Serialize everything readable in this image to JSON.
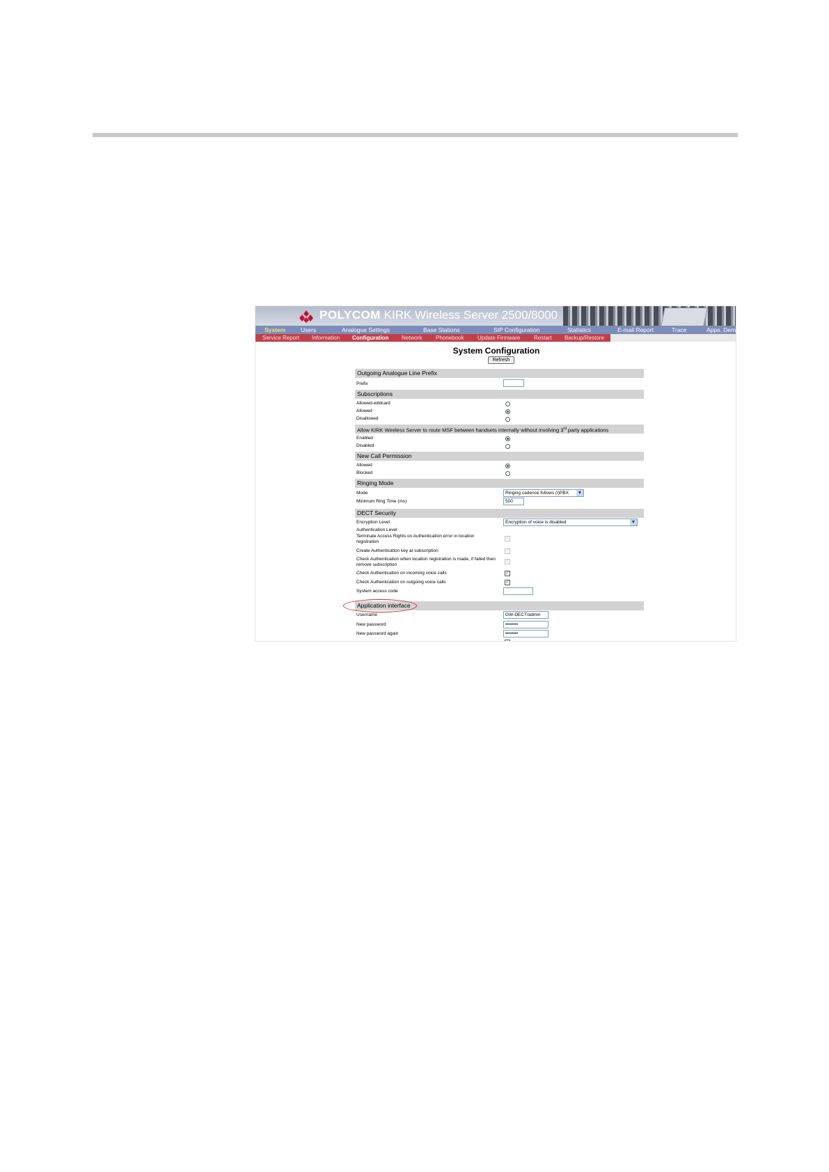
{
  "browser_screenshot": {
    "banner": {
      "brand": "POLYCOM",
      "product": "KIRK Wireless Server 2500/8000",
      "colors": {
        "logo": "#c8102e",
        "nav_main": "#7d8db9",
        "nav_sub": "#c0404a",
        "section_bar": "#d2d2d2",
        "highlight_ellipse": "#d12a2a"
      }
    },
    "main_nav": [
      "System",
      "Users",
      "Analogue Settings",
      "Base Stations",
      "SIP Configuration",
      "Statistics",
      "E-mail Report",
      "Trace",
      "Apps. Demo"
    ],
    "main_nav_selected": "System",
    "sub_nav": [
      "Service Report",
      "Information",
      "Configuration",
      "Network",
      "Phonebook",
      "Update Firmware",
      "Restart",
      "Backup/Restore"
    ],
    "sub_nav_selected": "Configuration",
    "page_title": "System Configuration",
    "refresh_label": "Refresh",
    "sections": {
      "outgoing_prefix": {
        "title": "Outgoing Analogue Line Prefix",
        "prefix_label": "Prefix",
        "prefix_value": ""
      },
      "subscriptions": {
        "title": "Subscriptions",
        "options": [
          "Allowed-wildcard",
          "Allowed",
          "Disallowed"
        ],
        "selected": "Allowed"
      },
      "route_msf": {
        "title_pre": "Allow KIRK Wireless Server to route MSF between handsets internally without involving 3",
        "title_sup": "rd",
        "title_post": " party applications",
        "options": [
          "Enabled",
          "Disabled"
        ],
        "selected": "Enabled"
      },
      "new_call": {
        "title": "New Call Permission",
        "options": [
          "Allowed",
          "Blocked"
        ],
        "selected": "Allowed"
      },
      "ringing": {
        "title": "Ringing Mode",
        "mode_label": "Mode",
        "mode_value": "Ringing cadence follows (I)PBX",
        "min_ring_label": "Minimum Ring Time (ms)",
        "min_ring_value": "500"
      },
      "dect_security": {
        "title": "DECT Security",
        "encryption_label": "Encryption Level",
        "encryption_value": "Encryption of voice is disabled",
        "auth_level_label": "Authentication Level",
        "terminate_label": "Terminate Access Rights on Authentication error in location registration",
        "create_key_label": "Create Authentication key at subscription",
        "check_location_label": "Check Authentication when location registration is made, if failed then remove subscription",
        "check_incoming_label": "Check Authentication on incoming voice calls",
        "check_outgoing_label": "Check Authentication on outgoing voice calls",
        "system_access_label": "System access code",
        "system_access_value": "",
        "checked_states": {
          "terminate": true,
          "create_key": true,
          "check_location": true,
          "check_incoming": true,
          "check_outgoing": true
        }
      },
      "app_interface": {
        "title": "Application interface",
        "username_label": "Username",
        "username_value": "GW-DECT/admin",
        "new_password_label": "New password",
        "new_password_value": "••••••••",
        "new_password_again_label": "New password again",
        "new_password_again_value": "••••••••"
      }
    }
  }
}
